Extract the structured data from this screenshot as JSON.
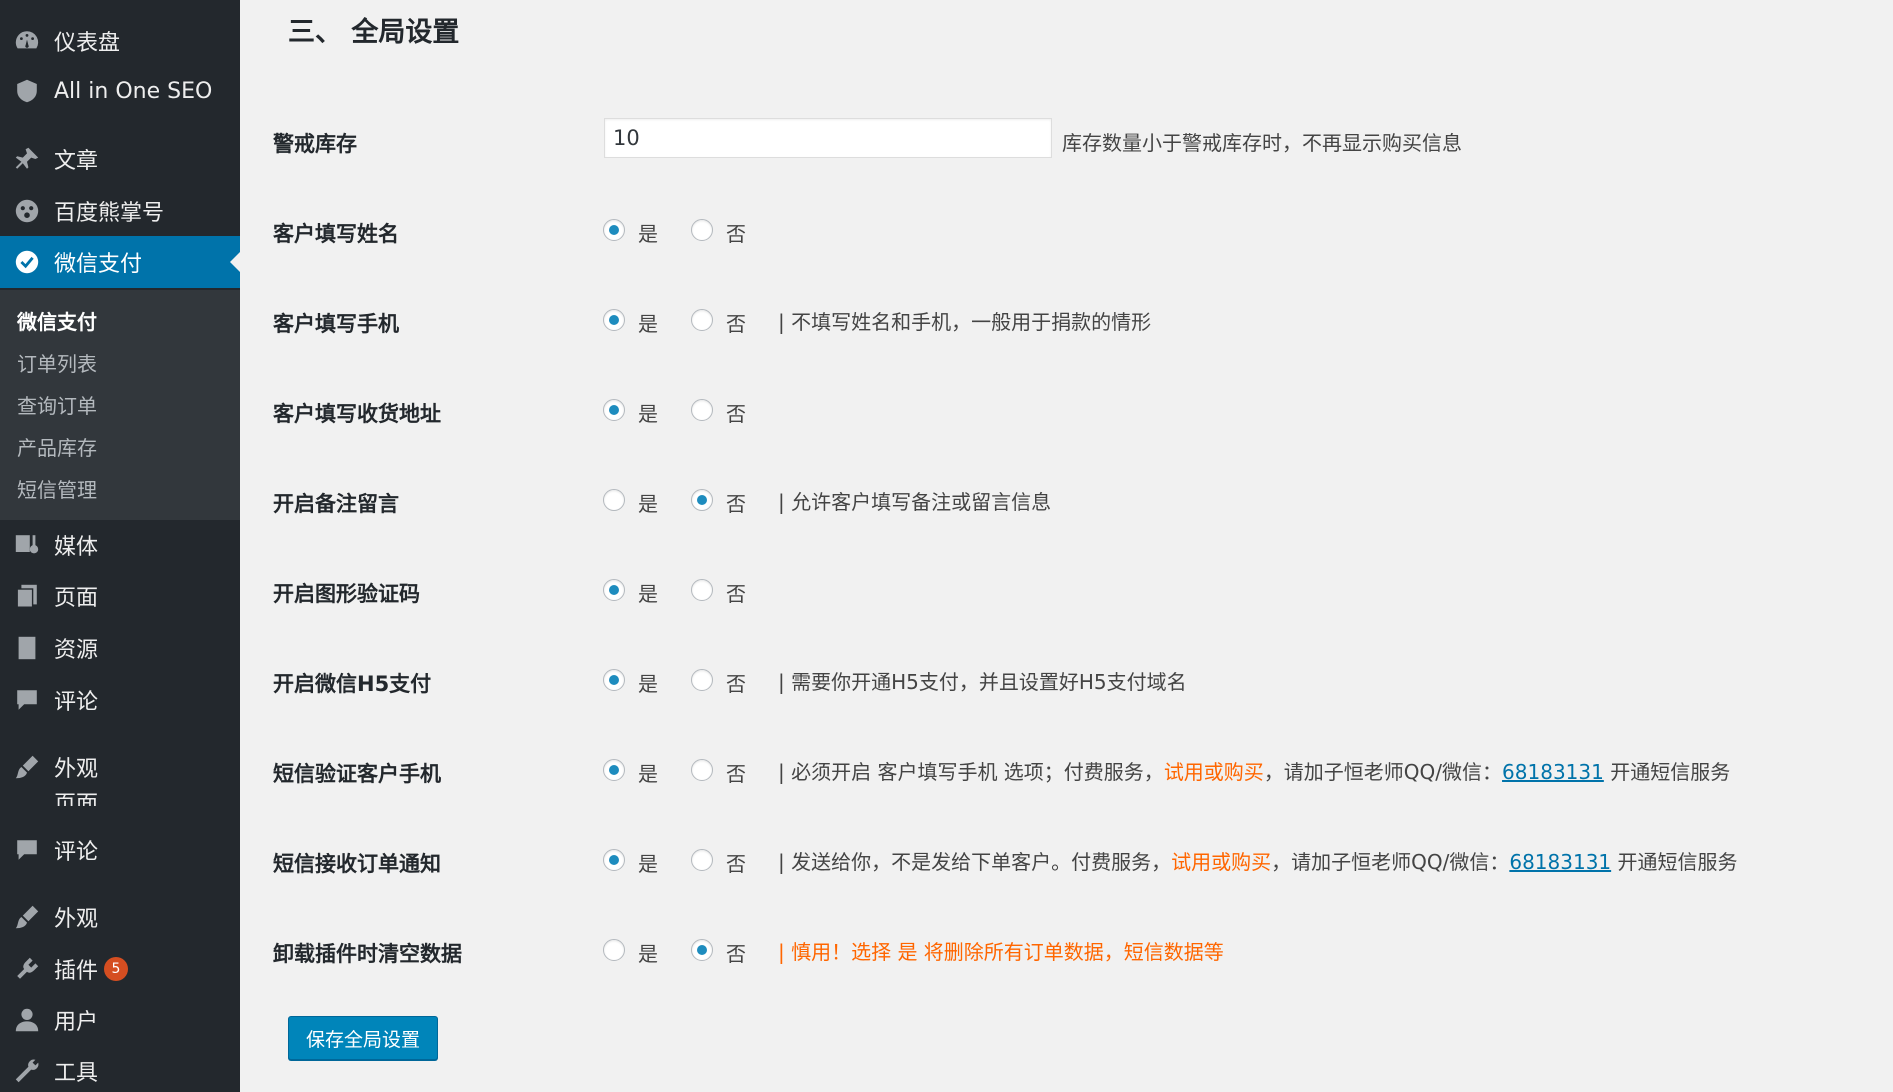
{
  "sidebar": {
    "items": [
      {
        "label": "仪表盘",
        "icon": "dashboard-icon"
      },
      {
        "label": "All in One SEO",
        "icon": "shield-icon"
      },
      {
        "label": "文章",
        "icon": "pin-icon"
      },
      {
        "label": "百度熊掌号",
        "icon": "paw-icon"
      },
      {
        "label": "微信支付",
        "icon": "check-circle-icon",
        "active": true
      },
      {
        "label": "媒体",
        "icon": "media-icon"
      },
      {
        "label": "页面",
        "icon": "page-icon"
      },
      {
        "label": "资源",
        "icon": "book-icon"
      },
      {
        "label": "评论",
        "icon": "comment-icon"
      },
      {
        "label": "外观",
        "icon": "brush-icon"
      },
      {
        "label": "页面",
        "icon": "page-icon"
      },
      {
        "label": "评论",
        "icon": "comment-icon"
      },
      {
        "label": "外观",
        "icon": "brush-icon"
      },
      {
        "label": "插件",
        "icon": "plug-icon",
        "badge": "5"
      },
      {
        "label": "用户",
        "icon": "user-icon"
      },
      {
        "label": "工具",
        "icon": "wrench-icon"
      }
    ],
    "submenu": [
      "微信支付",
      "订单列表",
      "查询订单",
      "产品库存",
      "短信管理"
    ]
  },
  "page": {
    "title": "三、 全局设置",
    "save_label": "保存全局设置",
    "yes_label": "是",
    "no_label": "否"
  },
  "settings": [
    {
      "label": "警戒库存",
      "type": "input",
      "value": "10",
      "help": "库存数量小于警戒库存时，不再显示购买信息"
    },
    {
      "label": "客户填写姓名",
      "selected": "yes"
    },
    {
      "label": "客户填写手机",
      "selected": "yes",
      "help": "| 不填写姓名和手机，一般用于捐款的情形"
    },
    {
      "label": "客户填写收货地址",
      "selected": "yes"
    },
    {
      "label": "开启备注留言",
      "selected": "no",
      "help": "| 允许客户填写备注或留言信息"
    },
    {
      "label": "开启图形验证码",
      "selected": "yes"
    },
    {
      "label": "开启微信H5支付",
      "selected": "yes",
      "help": "| 需要你开通H5支付，并且设置好H5支付域名"
    },
    {
      "label": "短信验证客户手机",
      "selected": "yes",
      "help_a": "| 必须开启 客户填写手机 选项；付费服务，",
      "help_orange": "试用或购买",
      "help_b": "，请加子恒老师QQ/微信：",
      "help_link": "68183131",
      "help_c": " 开通短信服务"
    },
    {
      "label": "短信接收订单通知",
      "selected": "yes",
      "help_a": "| 发送给你，不是发给下单客户。付费服务，",
      "help_orange": "试用或购买",
      "help_b": "，请加子恒老师QQ/微信：",
      "help_link": "68183131",
      "help_c": " 开通短信服务"
    },
    {
      "label": "卸载插件时清空数据",
      "selected": "no",
      "help_warning": "| 慎用！选择 是 将删除所有订单数据，短信数据等"
    }
  ]
}
